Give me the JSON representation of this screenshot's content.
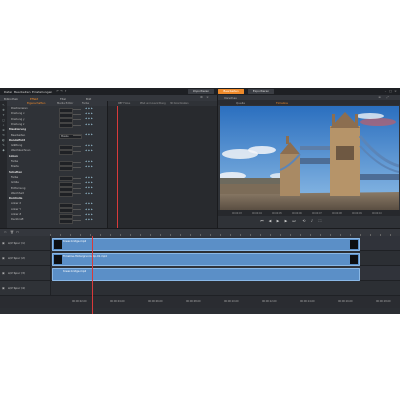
{
  "window": {
    "menu": [
      "Datei",
      "Bearbeiten",
      "Einstellungen"
    ],
    "mode_tabs": [
      {
        "label": "Importieren",
        "active": false
      },
      {
        "label": "Bearbeiten",
        "active": true
      },
      {
        "label": "Exportieren",
        "active": false
      }
    ]
  },
  "editor_tabs": [
    "Bibliothek",
    "Effekt",
    "Titel",
    "Bild"
  ],
  "props_columns": [
    "Eigenschaften",
    "Media Editor",
    "Farbe",
    "RBF Fokus",
    "Pfad und Ausrichtung",
    "3D Koordinaten"
  ],
  "properties": [
    {
      "label": "Positionieren",
      "section": false
    },
    {
      "label": "Drehung x",
      "section": false
    },
    {
      "label": "Drehung y",
      "section": false
    },
    {
      "label": "Drehung z",
      "section": false
    },
    {
      "label": "Maskierung",
      "section": true
    },
    {
      "label": "Bearbeiten",
      "section": false,
      "value": "Maske"
    },
    {
      "label": "Randeffekt",
      "section": true
    },
    {
      "label": "Glättung",
      "section": false
    },
    {
      "label": "Weichzeichnen",
      "section": false
    },
    {
      "label": "Linien",
      "section": true
    },
    {
      "label": "Farbe",
      "section": false
    },
    {
      "label": "Breite",
      "section": false
    },
    {
      "label": "Schatten",
      "section": true
    },
    {
      "label": "Farbe",
      "section": false
    },
    {
      "label": "Größe",
      "section": false
    },
    {
      "label": "Entfernung",
      "section": false
    },
    {
      "label": "Weichheit",
      "section": false
    },
    {
      "label": "Kontrolle",
      "section": true
    },
    {
      "label": "Anker X",
      "section": false
    },
    {
      "label": "Anker Y",
      "section": false
    },
    {
      "label": "Anker Z",
      "section": false
    },
    {
      "label": "Deckkraft",
      "section": false
    }
  ],
  "preview": {
    "title": "Vorschau",
    "tabs": [
      {
        "label": "Quelle",
        "sel": false
      },
      {
        "label": "Timeline",
        "sel": true
      }
    ],
    "timecodes": [
      "00:00:03",
      "00:00:04",
      "00:00:05",
      "00:00:06",
      "00:00:07",
      "00:00:08",
      "00:00:09",
      "00:00:10"
    ]
  },
  "tracks": [
    {
      "name": "A/V Spur (1)",
      "clips": [
        {
          "label": "tower-bridge.mp4",
          "dark_thumb": true
        }
      ]
    },
    {
      "name": "A/V Spur (2)",
      "clips": [
        {
          "label": "Timeline-Hintergrund-clip-01.mp4",
          "dark_thumb": true
        }
      ]
    },
    {
      "name": "A/V Spur (3)",
      "clips": [
        {
          "label": "tower-bridge.mp4",
          "dark_thumb": false
        }
      ]
    },
    {
      "name": "A/V Spur (4)",
      "clips": []
    }
  ],
  "ruler_labels": [
    "00:00:02.00",
    "00:00:04.00",
    "00:00:06.00",
    "00:00:08.00",
    "00:00:10.00",
    "00:00:12.00",
    "00:00:14.00",
    "00:00:16.00",
    "00:00:18.00"
  ],
  "colors": {
    "accent": "#ef8a2a",
    "clip": "#5b8fc7",
    "playhead": "#d83a3a"
  }
}
